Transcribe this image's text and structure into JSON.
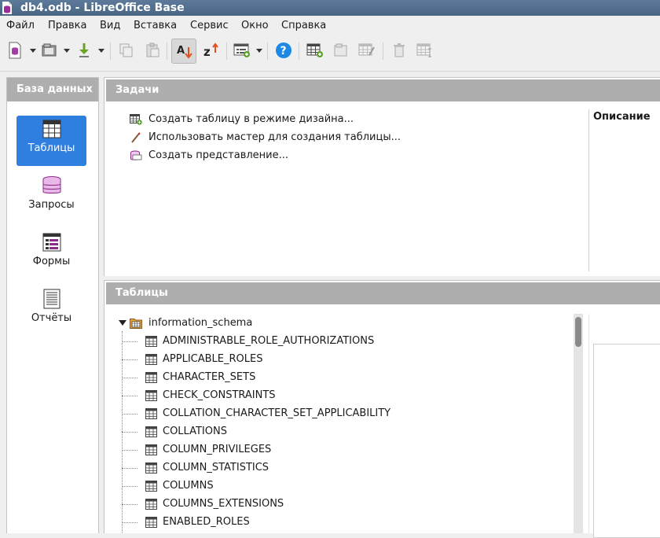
{
  "window": {
    "title": "db4.odb - LibreOffice Base"
  },
  "menu": [
    "Файл",
    "Правка",
    "Вид",
    "Вставка",
    "Сервис",
    "Окно",
    "Справка"
  ],
  "toolbar": {
    "buttons": [
      "new-icon",
      "open-icon",
      "save-icon",
      "copy-icon",
      "paste-icon",
      "sort-ascending-icon",
      "sort-descending-icon",
      "form-icon",
      "help-icon",
      "new-table-icon",
      "open-table-icon",
      "edit-table-icon",
      "delete-icon",
      "rename-icon"
    ]
  },
  "left_panel": {
    "header": "База данных",
    "items": [
      {
        "label": "Таблицы",
        "icon": "table-icon",
        "selected": true
      },
      {
        "label": "Запросы",
        "icon": "query-icon",
        "selected": false
      },
      {
        "label": "Формы",
        "icon": "form-icon",
        "selected": false
      },
      {
        "label": "Отчёты",
        "icon": "report-icon",
        "selected": false
      }
    ]
  },
  "tasks": {
    "header": "Задачи",
    "items": [
      {
        "label": "Создать таблицу в режиме дизайна...",
        "icon": "table-design-icon"
      },
      {
        "label": "Использовать мастер для создания таблицы...",
        "icon": "wizard-icon"
      },
      {
        "label": "Создать представление...",
        "icon": "view-icon"
      }
    ],
    "description_label": "Описание"
  },
  "tables": {
    "header": "Таблицы",
    "root": "information_schema",
    "rows": [
      "ADMINISTRABLE_ROLE_AUTHORIZATIONS",
      "APPLICABLE_ROLES",
      "CHARACTER_SETS",
      "CHECK_CONSTRAINTS",
      "COLLATION_CHARACTER_SET_APPLICABILITY",
      "COLLATIONS",
      "COLUMN_PRIVILEGES",
      "COLUMN_STATISTICS",
      "COLUMNS",
      "COLUMNS_EXTENSIONS",
      "ENABLED_ROLES"
    ]
  },
  "colors": {
    "selection": "#2f7fe0",
    "header_bg": "#aeaeae",
    "title_bg": "#4a6584"
  }
}
